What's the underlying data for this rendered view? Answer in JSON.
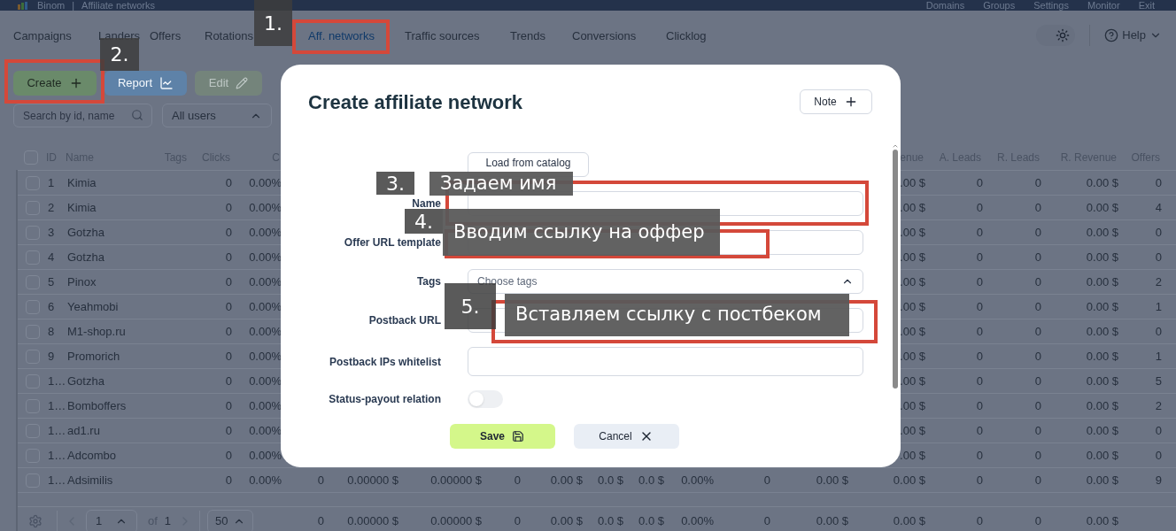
{
  "top_bar": {
    "brand": "Binom",
    "separator": "|",
    "page_title": "Affiliate networks",
    "links": [
      "Domains",
      "Groups",
      "Settings",
      "Monitor",
      "Exit"
    ]
  },
  "nav": {
    "tabs": [
      {
        "label": "Campaigns",
        "selected": false
      },
      {
        "label": "Landers",
        "selected": false
      },
      {
        "label": "Offers",
        "selected": false
      },
      {
        "label": "Rotations",
        "selected": false
      },
      {
        "label": "Aff. networks",
        "selected": true
      },
      {
        "label": "Traffic sources",
        "selected": false
      },
      {
        "label": "Trends",
        "selected": false
      },
      {
        "label": "Conversions",
        "selected": false
      },
      {
        "label": "Clicklog",
        "selected": false
      }
    ],
    "help": "Help"
  },
  "toolbar": {
    "buttons": [
      {
        "label": "Create",
        "kind": "create",
        "disabled": false
      },
      {
        "label": "Report",
        "kind": "report",
        "disabled": false
      },
      {
        "label": "Edit",
        "kind": "edit",
        "disabled": true
      }
    ],
    "search": {
      "placeholder": "Search by id, name"
    },
    "user_filter": "All users"
  },
  "table": {
    "header_checked": false,
    "columns": [
      "ID",
      "Name",
      "Tags",
      "Clicks",
      "C",
      "enue",
      "A. Leads",
      "R. Leads",
      "R. Revenue",
      "Offers"
    ],
    "rows": [
      {
        "checked": false,
        "id": "1",
        "name": "Kimia",
        "clicks": "0",
        "cr": "0.00%",
        "revenue": ".00 $",
        "a_leads": "0",
        "r_leads": "0",
        "r_revenue": "0.00 $",
        "offers": "0"
      },
      {
        "checked": false,
        "id": "2",
        "name": "Kimia",
        "clicks": "0",
        "cr": "0.00%",
        "revenue": ".00 $",
        "a_leads": "0",
        "r_leads": "0",
        "r_revenue": "0.00 $",
        "offers": "4"
      },
      {
        "checked": false,
        "id": "3",
        "name": "Gotzha",
        "clicks": "0",
        "cr": "0.00%",
        "revenue": ".00 $",
        "a_leads": "0",
        "r_leads": "0",
        "r_revenue": "0.00 $",
        "offers": "0"
      },
      {
        "checked": false,
        "id": "4",
        "name": "Gotzha",
        "clicks": "0",
        "cr": "0.00%",
        "revenue": ".00 $",
        "a_leads": "0",
        "r_leads": "0",
        "r_revenue": "0.00 $",
        "offers": "0"
      },
      {
        "checked": false,
        "id": "5",
        "name": "Pinox",
        "clicks": "0",
        "cr": "0.00%",
        "revenue": ".00 $",
        "a_leads": "0",
        "r_leads": "0",
        "r_revenue": "0.00 $",
        "offers": "2"
      },
      {
        "checked": false,
        "id": "6",
        "name": "Yeahmobi",
        "clicks": "0",
        "cr": "0.00%",
        "revenue": ".00 $",
        "a_leads": "0",
        "r_leads": "0",
        "r_revenue": "0.00 $",
        "offers": "1"
      },
      {
        "checked": false,
        "id": "8",
        "name": "M1-shop.ru",
        "clicks": "0",
        "cr": "0.00%",
        "revenue": ".00 $",
        "a_leads": "0",
        "r_leads": "0",
        "r_revenue": "0.00 $",
        "offers": "0"
      },
      {
        "checked": false,
        "id": "9",
        "name": "Promorich",
        "clicks": "0",
        "cr": "0.00%",
        "revenue": ".00 $",
        "a_leads": "0",
        "r_leads": "0",
        "r_revenue": "0.00 $",
        "offers": "1"
      },
      {
        "checked": false,
        "id": "1…",
        "name": "Gotzha",
        "clicks": "0",
        "cr": "0.00%",
        "revenue": ".00 $",
        "a_leads": "0",
        "r_leads": "0",
        "r_revenue": "0.00 $",
        "offers": "5"
      },
      {
        "checked": false,
        "id": "1…",
        "name": "Bomboffers",
        "clicks": "0",
        "cr": "0.00%",
        "revenue": ".00 $",
        "a_leads": "0",
        "r_leads": "0",
        "r_revenue": "0.00 $",
        "offers": "2"
      },
      {
        "checked": false,
        "id": "1…",
        "name": "ad1.ru",
        "clicks": "0",
        "cr": "0.00%",
        "revenue": ".00 $",
        "a_leads": "0",
        "r_leads": "0",
        "r_revenue": "0.00 $",
        "offers": "0"
      },
      {
        "checked": false,
        "id": "1…",
        "name": "Adcombo",
        "clicks": "0",
        "cr": "0.00%",
        "revenue": ".00 $",
        "a_leads": "0",
        "r_leads": "0",
        "r_revenue": "0.00 $",
        "offers": "0"
      },
      {
        "checked": false,
        "id": "1…",
        "name": "Adsimilis",
        "clicks": "0",
        "cr": "0.00%",
        "middle": [
          "0",
          "0.00000 $",
          "0.00000 $",
          "0",
          "0.00 $",
          "0.0 $",
          "0.0 $",
          "0.00%",
          "0",
          "0.00 $"
        ],
        "revenue": "0.00 $",
        "a_leads": "0",
        "r_leads": "0",
        "r_revenue": "0.00 $",
        "offers": "9"
      }
    ],
    "footer": {
      "page": "1",
      "of": "of",
      "pages": "1",
      "per_page": "50",
      "totals": [
        "0",
        "0.00000 $",
        "0.00000 $",
        "0",
        "0.00 $",
        "0.0 $",
        "0.0 $",
        "0.00%",
        "0",
        "0.00 $",
        "0.00 $",
        "0",
        "0",
        "0.00 $"
      ]
    }
  },
  "modal": {
    "title": "Create affiliate network",
    "note_button": "Note",
    "load_button": "Load from catalog",
    "fields": [
      {
        "label": "Name",
        "kind": "text"
      },
      {
        "label": "Offer URL template",
        "kind": "text"
      },
      {
        "label": "Tags",
        "kind": "select",
        "placeholder": "Choose tags"
      },
      {
        "label": "Postback URL",
        "kind": "text"
      },
      {
        "label": "Postback IPs whitelist",
        "kind": "textarea"
      },
      {
        "label": "Status-payout relation",
        "kind": "toggle",
        "on": false
      }
    ],
    "save": "Save",
    "cancel": "Cancel"
  },
  "annotations": [
    {
      "number": "1."
    },
    {
      "number": "2."
    },
    {
      "number": "3.",
      "caption": "Задаем имя"
    },
    {
      "number": "4.",
      "caption": "Вводим ссылку на оффер"
    },
    {
      "number": "5.",
      "caption": "Вставляем ссылку с постбеком"
    }
  ]
}
